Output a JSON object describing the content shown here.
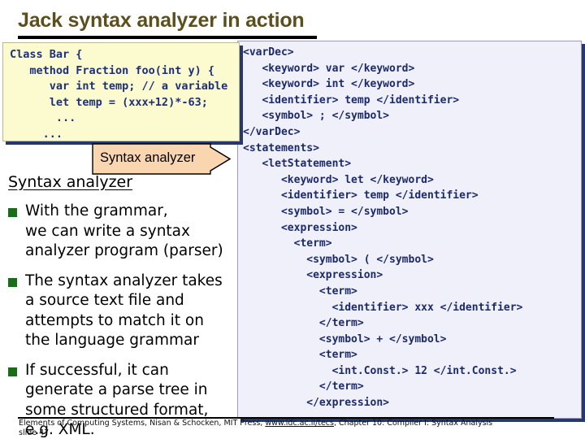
{
  "slide": {
    "title": "Jack syntax analyzer in action",
    "title_color": "#5c4f1e"
  },
  "code_panel": {
    "name": "jack-source-code",
    "background": "#fcfbcf",
    "text_color": "#1c2f7a",
    "code": "Class Bar {\n   method Fraction foo(int y) {\n      var int temp; // a variable\n      let temp = (xxx+12)*-63;\n       ...\n     ..."
  },
  "xml_panel": {
    "name": "xml-parse-tree-output",
    "background": "#f0f0fb",
    "text_color": "#1b2a6b",
    "xml": "<varDec>\n   <keyword> var </keyword>\n   <keyword> int </keyword>\n   <identifier> temp </identifier>\n   <symbol> ; </symbol>\n</varDec>\n<statements>\n   <letStatement>\n      <keyword> let </keyword>\n      <identifier> temp </identifier>\n      <symbol> = </symbol>\n      <expression>\n        <term>\n          <symbol> ( </symbol>\n          <expression>\n            <term>\n              <identifier> xxx </identifier>\n            </term>\n            <symbol> + </symbol>\n            <term>\n              <int.Const.> 12 </int.Const.>\n            </term>\n          </expression>\n       ..."
  },
  "arrow_banner": {
    "label": "Syntax analyzer",
    "fill": "#fad6b0",
    "stroke": "#000000"
  },
  "content": {
    "heading": "Syntax analyzer",
    "bullet_color": "#1a6b1a",
    "bullets": [
      "With the grammar,\nwe can write a syntax\nanalyzer program (parser)",
      "The syntax analyzer takes\na source text file and\nattempts to match it on\nthe language grammar",
      "If successful, it can\ngenerate a parse tree in\nsome structured format,\ne.g.  XML."
    ]
  },
  "footer": {
    "prefix": "Elements of Computing Systems, Nisan & Schocken, MIT Press, ",
    "link": "www.idc.ac.il/tecs",
    "suffix": ", Chapter 10: Compiler I: Syntax Analysis",
    "slide_number": "slide 47"
  }
}
